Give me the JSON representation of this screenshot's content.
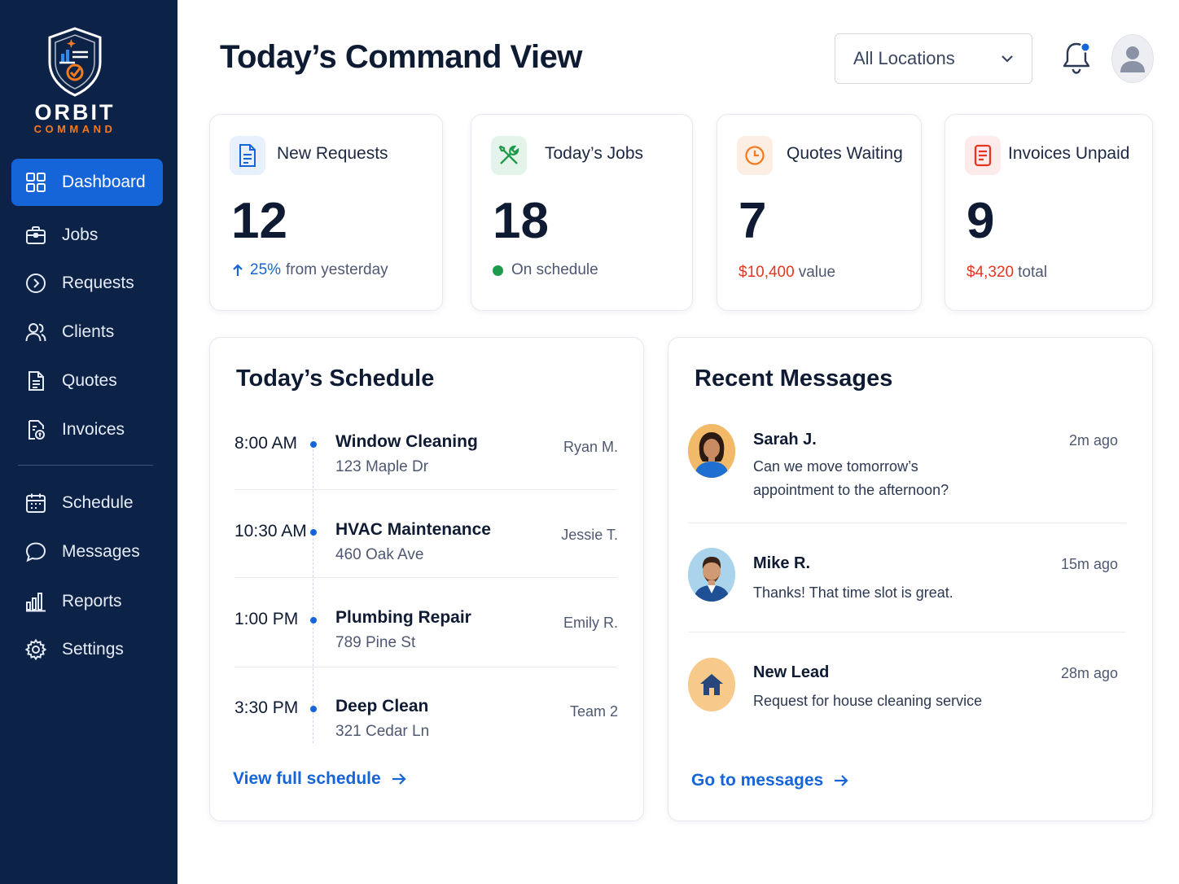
{
  "brand": {
    "name": "ORBIT",
    "sub": "COMMAND"
  },
  "sidebar": {
    "items": [
      {
        "label": "Dashboard",
        "icon": "grid-icon"
      },
      {
        "label": "Jobs",
        "icon": "briefcase-icon"
      },
      {
        "label": "Requests",
        "icon": "arrow-circle-icon"
      },
      {
        "label": "Clients",
        "icon": "users-icon"
      },
      {
        "label": "Quotes",
        "icon": "document-icon"
      },
      {
        "label": "Invoices",
        "icon": "invoice-icon"
      },
      {
        "label": "Schedule",
        "icon": "calendar-icon"
      },
      {
        "label": "Messages",
        "icon": "chat-icon"
      },
      {
        "label": "Reports",
        "icon": "bar-chart-icon"
      },
      {
        "label": "Settings",
        "icon": "gear-icon"
      }
    ],
    "active": "Dashboard"
  },
  "header": {
    "title": "Today’s Command View",
    "location_select": "All Locations",
    "notification_badge_color": "#1565d8"
  },
  "stats": [
    {
      "label": "New Requests",
      "value": "12",
      "highlight": "25%",
      "detail": "from yesterday",
      "icon": "file-icon",
      "color": "#1565d8"
    },
    {
      "label": "Today’s Jobs",
      "value": "18",
      "detail": "On schedule",
      "icon": "tools-icon",
      "color": "#1e9b4a"
    },
    {
      "label": "Quotes Waiting",
      "value": "7",
      "highlight": "$10,400",
      "detail": "value",
      "icon": "clock-icon",
      "color": "#f47a20"
    },
    {
      "label": "Invoices Unpaid",
      "value": "9",
      "highlight": "$4,320",
      "detail": "total",
      "icon": "receipt-icon",
      "color": "#e5361f"
    }
  ],
  "schedule": {
    "title": "Today’s Schedule",
    "items": [
      {
        "time": "8:00 AM",
        "job": "Window Cleaning",
        "address": "123 Maple Dr",
        "assignee": "Ryan M."
      },
      {
        "time": "10:30 AM",
        "job": "HVAC Maintenance",
        "address": "460 Oak Ave",
        "assignee": "Jessie T."
      },
      {
        "time": "1:00 PM",
        "job": "Plumbing Repair",
        "address": "789 Pine St",
        "assignee": "Emily R."
      },
      {
        "time": "3:30 PM",
        "job": "Deep Clean",
        "address": "321 Cedar Ln",
        "assignee": "Team 2"
      }
    ],
    "link": "View full schedule"
  },
  "messages": {
    "title": "Recent Messages",
    "items": [
      {
        "name": "Sarah J.",
        "text": "Can we move tomorrow’s appointment to the afternoon?",
        "time": "2m ago",
        "avatar": "woman-avatar"
      },
      {
        "name": "Mike R.",
        "text": "Thanks! That time slot is great.",
        "time": "15m ago",
        "avatar": "man-avatar"
      },
      {
        "name": "New Lead",
        "text": "Request for house cleaning service",
        "time": "28m ago",
        "avatar": "house-icon"
      }
    ],
    "link": "Go to messages"
  }
}
